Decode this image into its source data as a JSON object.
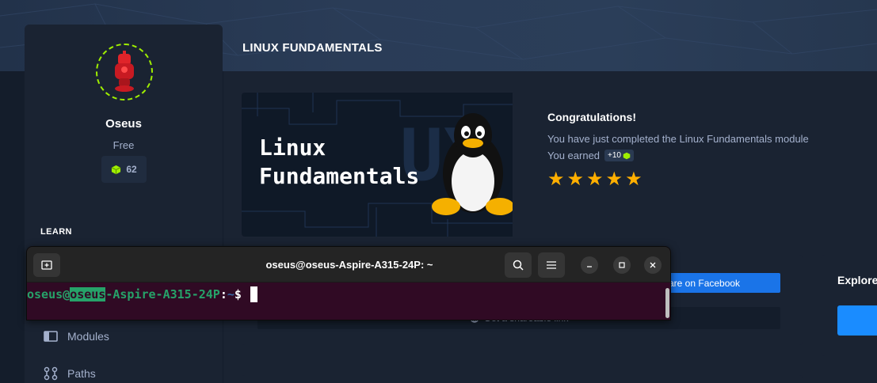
{
  "sidebar": {
    "username": "Oseus",
    "plan": "Free",
    "cubes": "62",
    "section_label": "LEARN",
    "nav": [
      {
        "label": "Modules",
        "icon": "modules-icon"
      },
      {
        "label": "Paths",
        "icon": "paths-icon"
      }
    ]
  },
  "page": {
    "title": "LINUX FUNDAMENTALS",
    "banner_title": "Linux\nFundamentals",
    "congrats_heading": "Congratulations!",
    "congrats_text": "You have just completed the Linux Fundamentals module",
    "earned_label": "You earned",
    "earned_badge": "+10",
    "stars": 5
  },
  "share": {
    "facebook_label": "are on Facebook",
    "shareable_label": "Get a shareable link"
  },
  "explore": {
    "title": "Explore"
  },
  "terminal": {
    "title": "oseus@oseus-Aspire-A315-24P: ~",
    "prompt_user": "oseus@",
    "prompt_host_hl": "oseus",
    "prompt_host_rest": "-Aspire-A315-24P",
    "prompt_colon": ":",
    "prompt_path": "~",
    "prompt_dollar": "$ "
  },
  "colors": {
    "accent_green": "#9fef00",
    "star": "#ffaf00",
    "facebook": "#1a74e8",
    "terminal_bg": "#300a24"
  }
}
